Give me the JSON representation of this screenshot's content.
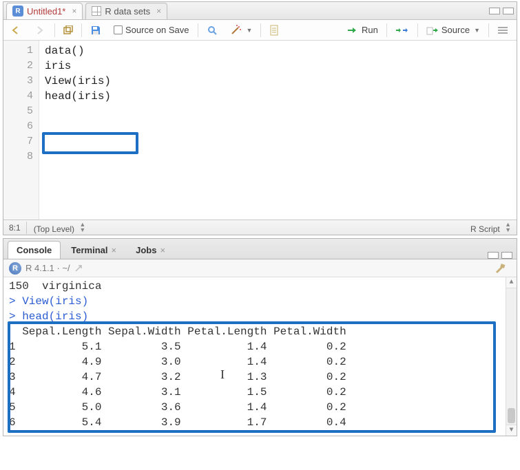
{
  "editor": {
    "tabs": [
      {
        "label": "Untitled1*",
        "icon": "r-file-icon",
        "active": true
      },
      {
        "label": "R data sets",
        "icon": "table-icon",
        "active": false
      }
    ],
    "toolbar": {
      "source_on_save": "Source on Save",
      "run": "Run",
      "source": "Source"
    },
    "lines": [
      "1",
      "2",
      "3",
      "4",
      "5",
      "6",
      "7",
      "8"
    ],
    "code": [
      "data()",
      "",
      "iris",
      "",
      "View(iris)",
      "",
      "head(iris)",
      ""
    ],
    "status": {
      "pos": "8:1",
      "scope": "(Top Level)",
      "lang": "R Script"
    }
  },
  "console": {
    "tabs": [
      "Console",
      "Terminal",
      "Jobs"
    ],
    "session": "R 4.1.1 · ~/",
    "pre_lines": [
      "150  virginica",
      "> View(iris)"
    ],
    "output_cmd": "> head(iris)",
    "output_header": "  Sepal.Length Sepal.Width Petal.Length Petal.Width",
    "output_rows": [
      "1          5.1         3.5          1.4         0.2",
      "2          4.9         3.0          1.4         0.2",
      "3          4.7         3.2          1.3         0.2",
      "4          4.6         3.1          1.5         0.2",
      "5          5.0         3.6          1.4         0.2",
      "6          5.4         3.9          1.7         0.4"
    ]
  },
  "chart_data": {
    "type": "table",
    "title": "head(iris)",
    "columns": [
      "Sepal.Length",
      "Sepal.Width",
      "Petal.Length",
      "Petal.Width"
    ],
    "rows": [
      [
        5.1,
        3.5,
        1.4,
        0.2
      ],
      [
        4.9,
        3.0,
        1.4,
        0.2
      ],
      [
        4.7,
        3.2,
        1.3,
        0.2
      ],
      [
        4.6,
        3.1,
        1.5,
        0.2
      ],
      [
        5.0,
        3.6,
        1.4,
        0.2
      ],
      [
        5.4,
        3.9,
        1.7,
        0.4
      ]
    ]
  }
}
